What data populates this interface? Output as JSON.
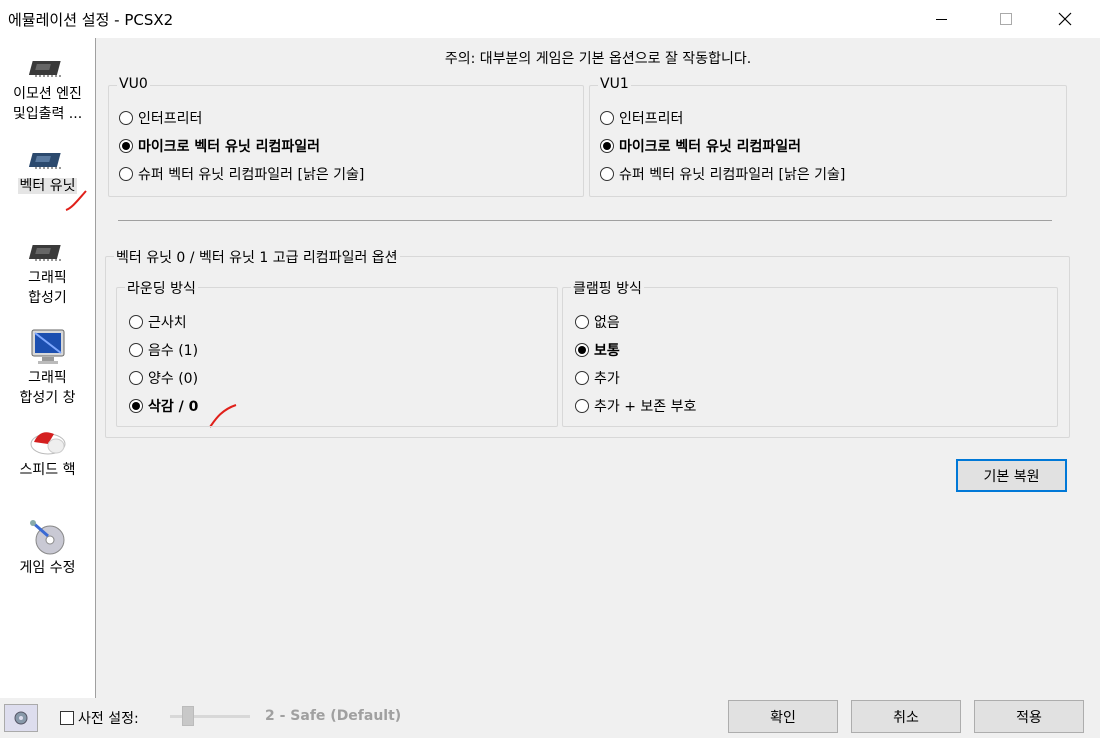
{
  "window": {
    "title": "에뮬레이션 설정 - PCSX2"
  },
  "sidebar": {
    "items": [
      {
        "label_line1": "이모션 엔진",
        "label_line2": "및입출력 ...",
        "icon": "chip-icon"
      },
      {
        "label_line1": "벡터 유닛",
        "icon": "chip-icon",
        "selected": true
      },
      {
        "label_line1": "그래픽",
        "label_line2": "합성기",
        "icon": "chip-icon"
      },
      {
        "label_line1": "그래픽",
        "label_line2": "합성기 창",
        "icon": "monitor-icon"
      },
      {
        "label_line1": "스피드 핵",
        "icon": "pill-icon"
      },
      {
        "label_line1": "게임 수정",
        "icon": "disc-icon"
      }
    ]
  },
  "notice": "주의: 대부분의 게임은 기본 옵션으로 잘 작동합니다.",
  "vu0": {
    "legend": "VU0",
    "options": [
      "인터프리터",
      "마이크로 벡터 유닛 리컴파일러",
      "슈퍼 벡터 유닛 리컴파일러 [낡은 기술]"
    ],
    "selected": 1
  },
  "vu1": {
    "legend": "VU1",
    "options": [
      "인터프리터",
      "마이크로 벡터 유닛 리컴파일러",
      "슈퍼 벡터 유닛 리컴파일러 [낡은 기술]"
    ],
    "selected": 1
  },
  "advanced": {
    "legend": "벡터 유닛 0 / 벡터 유닛 1 고급 리컴파일러 옵션",
    "rounding": {
      "legend": "라운딩 방식",
      "options": [
        "근사치",
        "음수 (1)",
        "양수 (0)",
        "삭감 / 0"
      ],
      "selected": 3
    },
    "clamping": {
      "legend": "클램핑 방식",
      "options": [
        "없음",
        "보통",
        "추가",
        "추가 + 보존 부호"
      ],
      "selected": 1
    }
  },
  "restore_button": "기본 복원",
  "bottom": {
    "preset_label": "사전 설정:",
    "preset_value": "2 - Safe (Default)",
    "ok": "확인",
    "cancel": "취소",
    "apply": "적용"
  },
  "colors": {
    "annotation": "#e0201a",
    "accent": "#0078d7"
  }
}
